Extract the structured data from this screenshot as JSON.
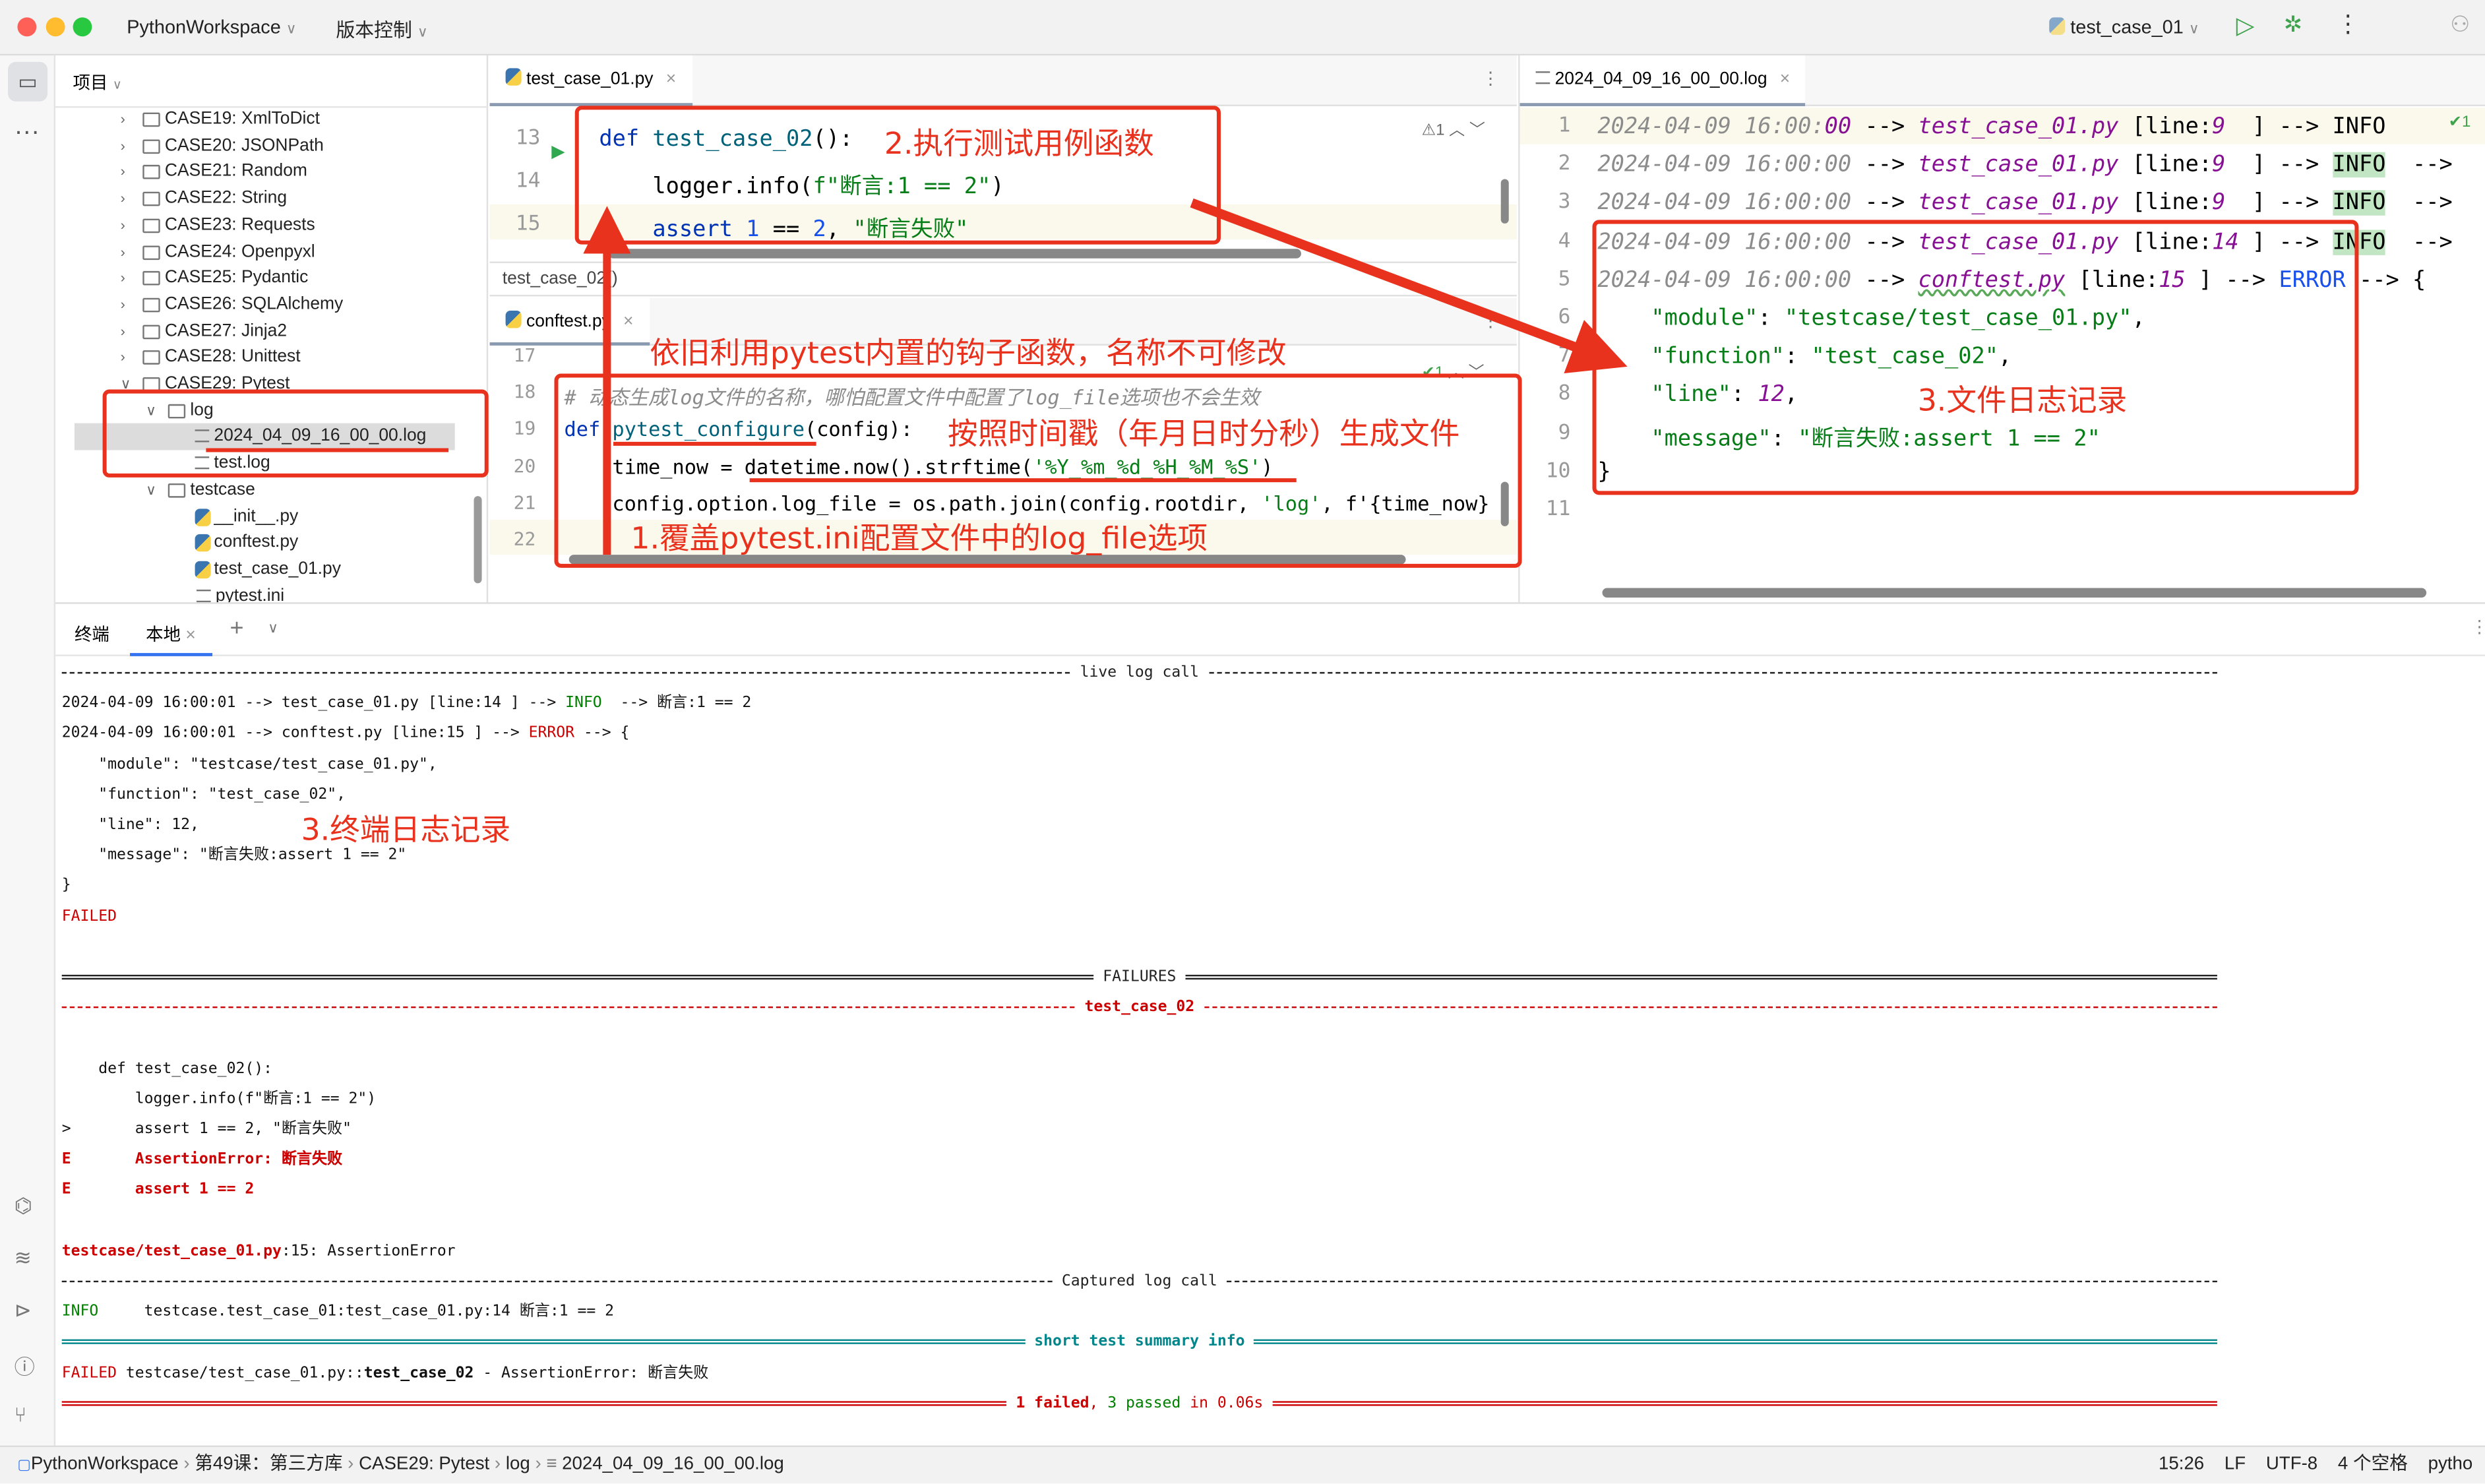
{
  "titlebar": {
    "project": "PythonWorkspace",
    "vcs": "版本控制",
    "run_config": "test_case_01"
  },
  "project_panel": {
    "title": "项目",
    "items": [
      {
        "label": "CASE19: XmlToDict",
        "type": "folder",
        "level": 0,
        "expanded": false
      },
      {
        "label": "CASE20: JSONPath",
        "type": "folder",
        "level": 0,
        "expanded": false
      },
      {
        "label": "CASE21: Random",
        "type": "folder",
        "level": 0,
        "expanded": false
      },
      {
        "label": "CASE22: String",
        "type": "folder",
        "level": 0,
        "expanded": false
      },
      {
        "label": "CASE23: Requests",
        "type": "folder",
        "level": 0,
        "expanded": false
      },
      {
        "label": "CASE24: Openpyxl",
        "type": "folder",
        "level": 0,
        "expanded": false
      },
      {
        "label": "CASE25: Pydantic",
        "type": "folder",
        "level": 0,
        "expanded": false
      },
      {
        "label": "CASE26: SQLAlchemy",
        "type": "folder",
        "level": 0,
        "expanded": false
      },
      {
        "label": "CASE27: Jinja2",
        "type": "folder",
        "level": 0,
        "expanded": false
      },
      {
        "label": "CASE28: Unittest",
        "type": "folder",
        "level": 0,
        "expanded": false
      },
      {
        "label": "CASE29: Pytest",
        "type": "folder",
        "level": 0,
        "expanded": true
      },
      {
        "label": "log",
        "type": "folder",
        "level": 1,
        "expanded": true
      },
      {
        "label": "2024_04_09_16_00_00.log",
        "type": "text",
        "level": 2,
        "selected": true
      },
      {
        "label": "test.log",
        "type": "text",
        "level": 2
      },
      {
        "label": "testcase",
        "type": "folder",
        "level": 1,
        "expanded": true
      },
      {
        "label": "__init__.py",
        "type": "python",
        "level": 2
      },
      {
        "label": "conftest.py",
        "type": "python",
        "level": 2
      },
      {
        "label": "test_case_01.py",
        "type": "python",
        "level": 2
      },
      {
        "label": "pytest.ini",
        "type": "ini",
        "level": 1
      }
    ]
  },
  "editor_top": {
    "tab": "test_case_01.py",
    "breadcrumb": "test_case_02()",
    "inspection": "1",
    "lines": [
      {
        "n": "13",
        "tokens": [
          [
            "def ",
            "kw"
          ],
          [
            "test_case_02",
            "fn"
          ],
          [
            "():",
            ""
          ]
        ]
      },
      {
        "n": "14",
        "tokens": [
          [
            "    logger.info(",
            ""
          ],
          [
            "f\"断言:1 == 2\"",
            "str"
          ],
          [
            ")",
            ""
          ]
        ]
      },
      {
        "n": "15",
        "tokens": [
          [
            "    ",
            ""
          ],
          [
            "assert ",
            "kw"
          ],
          [
            "1",
            "num"
          ],
          [
            " == ",
            ""
          ],
          [
            "2",
            "num"
          ],
          [
            ", ",
            ""
          ],
          [
            "\"断言失败\"",
            "str"
          ]
        ]
      }
    ]
  },
  "editor_bottom": {
    "tab": "conftest.py",
    "inspection": "1",
    "lines": [
      {
        "n": "17",
        "tokens": []
      },
      {
        "n": "18",
        "tokens": [
          [
            "# 动态生成log文件的名称，哪怕配置文件中配置了log_file选项也不会生效",
            "cm"
          ]
        ]
      },
      {
        "n": "19",
        "tokens": [
          [
            "def ",
            "kw"
          ],
          [
            "pytest_configure",
            "fn"
          ],
          [
            "(config):",
            ""
          ]
        ]
      },
      {
        "n": "20",
        "tokens": [
          [
            "    time_now = datetime.now().strftime(",
            ""
          ],
          [
            "'%Y_%m_%d_%H_%M_%S'",
            "str"
          ],
          [
            ")",
            ""
          ]
        ]
      },
      {
        "n": "21",
        "tokens": [
          [
            "    config.option.log_file = os.path.join(config.rootdir, ",
            ""
          ],
          [
            "'log'",
            "str"
          ],
          [
            ", f'{time_now}",
            ""
          ]
        ]
      },
      {
        "n": "22",
        "tokens": []
      }
    ]
  },
  "editor_log": {
    "tab": "2024_04_09_16_00_00.log",
    "inspection": "1",
    "lines": [
      {
        "n": "1",
        "tokens": [
          [
            "2024-04-09 16:00:",
            "ts"
          ],
          [
            "00",
            "ts2"
          ],
          [
            " --> ",
            ""
          ],
          [
            "test_case_01.py",
            "pf"
          ],
          [
            " [line:",
            ""
          ],
          [
            "9",
            "pn"
          ],
          [
            "  ] --> ",
            ""
          ],
          [
            "INFO",
            ""
          ]
        ]
      },
      {
        "n": "2",
        "tokens": [
          [
            "2024-04-09 16:00:00",
            "ts"
          ],
          [
            " --> ",
            ""
          ],
          [
            "test_case_01.py",
            "pf"
          ],
          [
            " [line:",
            ""
          ],
          [
            "9",
            "pn"
          ],
          [
            "  ] --> ",
            ""
          ],
          [
            "INFO",
            "info-bg"
          ],
          [
            "  -->",
            ""
          ]
        ]
      },
      {
        "n": "3",
        "tokens": [
          [
            "2024-04-09 16:00:00",
            "ts"
          ],
          [
            " --> ",
            ""
          ],
          [
            "test_case_01.py",
            "pf"
          ],
          [
            " [line:",
            ""
          ],
          [
            "9",
            "pn"
          ],
          [
            "  ] --> ",
            ""
          ],
          [
            "INFO",
            "info-bg"
          ],
          [
            "  -->",
            ""
          ]
        ]
      },
      {
        "n": "4",
        "tokens": [
          [
            "2024-04-09 16:00:00",
            "ts"
          ],
          [
            " --> ",
            ""
          ],
          [
            "test_case_01.py",
            "pf"
          ],
          [
            " [line:",
            ""
          ],
          [
            "14",
            "pn"
          ],
          [
            " ] --> ",
            ""
          ],
          [
            "INFO",
            "info-bg"
          ],
          [
            "  -->",
            ""
          ]
        ]
      },
      {
        "n": "5",
        "tokens": [
          [
            "2024-04-09 16:00:00",
            "ts"
          ],
          [
            " --> ",
            ""
          ],
          [
            "conftest.py",
            "pf wavy"
          ],
          [
            " [line:",
            ""
          ],
          [
            "15",
            "pn"
          ],
          [
            " ] --> ",
            ""
          ],
          [
            "ERROR",
            "err"
          ],
          [
            " --> {",
            ""
          ]
        ]
      },
      {
        "n": "6",
        "tokens": [
          [
            "    ",
            ""
          ],
          [
            "\"module\"",
            "str"
          ],
          [
            ": ",
            ""
          ],
          [
            "\"testcase/test_case_01.py\"",
            "str"
          ],
          [
            ",",
            ""
          ]
        ]
      },
      {
        "n": "7",
        "tokens": [
          [
            "    ",
            ""
          ],
          [
            "\"function\"",
            "str"
          ],
          [
            ": ",
            ""
          ],
          [
            "\"test_case_02\"",
            "str"
          ],
          [
            ",",
            ""
          ]
        ]
      },
      {
        "n": "8",
        "tokens": [
          [
            "    ",
            ""
          ],
          [
            "\"line\"",
            "str"
          ],
          [
            ": ",
            ""
          ],
          [
            "12",
            "pn"
          ],
          [
            ",",
            ""
          ]
        ]
      },
      {
        "n": "9",
        "tokens": [
          [
            "    ",
            ""
          ],
          [
            "\"message\"",
            "str"
          ],
          [
            ": ",
            ""
          ],
          [
            "\"断言失败:assert 1 == 2\"",
            "str"
          ]
        ]
      },
      {
        "n": "10",
        "tokens": [
          [
            "}",
            ""
          ]
        ]
      },
      {
        "n": "11",
        "tokens": []
      }
    ]
  },
  "terminal": {
    "title": "终端",
    "tab": "本地",
    "rows": [
      {
        "sep": "live log call",
        "style": "dash",
        "color": "#222"
      },
      {
        "tokens": [
          [
            "2024-04-09 16:00:01 --> test_case_01.py [line:14 ] --> ",
            ""
          ],
          [
            "INFO",
            "t-green"
          ],
          [
            "  --> 断言:1 == 2",
            ""
          ]
        ]
      },
      {
        "tokens": [
          [
            "2024-04-09 16:00:01 --> conftest.py [line:15 ] --> ",
            ""
          ],
          [
            "ERROR",
            "t-red"
          ],
          [
            " --> {",
            ""
          ]
        ]
      },
      {
        "tokens": [
          [
            "    \"module\": \"testcase/test_case_01.py\",",
            ""
          ]
        ]
      },
      {
        "tokens": [
          [
            "    \"function\": \"test_case_02\",",
            ""
          ]
        ]
      },
      {
        "tokens": [
          [
            "    \"line\": 12,",
            ""
          ]
        ]
      },
      {
        "tokens": [
          [
            "    \"message\": \"断言失败:assert 1 == 2\"",
            ""
          ]
        ]
      },
      {
        "tokens": [
          [
            "}",
            ""
          ]
        ]
      },
      {
        "tokens": [
          [
            "FAILED",
            "t-red"
          ]
        ]
      },
      {
        "tokens": []
      },
      {
        "sep": "FAILURES",
        "style": "double",
        "color": "#222"
      },
      {
        "sep": "test_case_02",
        "style": "dash",
        "color": "#cc0000",
        "bold": true
      },
      {
        "tokens": []
      },
      {
        "tokens": [
          [
            "    def test_case_02():",
            ""
          ]
        ]
      },
      {
        "tokens": [
          [
            "        logger.info(f\"断言:1 == 2\")",
            ""
          ]
        ]
      },
      {
        "tokens": [
          [
            ">       assert 1 == 2, \"断言失败\"",
            ""
          ]
        ]
      },
      {
        "tokens": [
          [
            "E       AssertionError: 断言失败",
            "t-red t-bold"
          ]
        ]
      },
      {
        "tokens": [
          [
            "E       assert 1 == 2",
            "t-red t-bold"
          ]
        ]
      },
      {
        "tokens": []
      },
      {
        "tokens": [
          [
            "testcase/test_case_01.py",
            "t-red t-bold"
          ],
          [
            ":15: AssertionError",
            ""
          ]
        ]
      },
      {
        "sep": "Captured log call",
        "style": "dash",
        "color": "#222"
      },
      {
        "tokens": [
          [
            "INFO",
            "t-green"
          ],
          [
            "     testcase.test_case_01:test_case_01.py:14 断言:1 == 2",
            ""
          ]
        ]
      },
      {
        "sep": "short test summary info",
        "style": "double",
        "color": "#00868b",
        "bold": true
      },
      {
        "tokens": [
          [
            "FAILED",
            "t-red"
          ],
          [
            " testcase/test_case_01.py::",
            ""
          ],
          [
            "test_case_02",
            "t-bold"
          ],
          [
            " - AssertionError: 断言失败",
            ""
          ]
        ]
      },
      {
        "sepTokens": [
          [
            "1 failed",
            "t-red t-bold"
          ],
          [
            ", ",
            ""
          ],
          [
            "3 passed",
            "t-green"
          ],
          [
            " in 0.06s",
            "t-red"
          ]
        ],
        "style": "double",
        "color": "#cc0000"
      }
    ]
  },
  "annotations": {
    "run_test": "2.执行测试用例函数",
    "hook": "依旧利用pytest内置的钩子函数，名称不可修改",
    "timestamp": "按照时间戳（年月日时分秒）生成文件",
    "override": "1.覆盖pytest.ini配置文件中的log_file选项",
    "file_log": "3.文件日志记录",
    "terminal_log": "3.终端日志记录"
  },
  "statusbar": {
    "breadcrumb": [
      "PythonWorkspace",
      "第49课：第三方库",
      "CASE29: Pytest",
      "log",
      "2024_04_09_16_00_00.log"
    ],
    "position": "15:26",
    "line_sep": "LF",
    "encoding": "UTF-8",
    "indent": "4 个空格",
    "interpreter": "pytho"
  },
  "colors": {
    "annotation": "#e8321e",
    "keyword": "#0033b3",
    "string": "#067d17",
    "error": "#cc0000",
    "success": "#008000"
  }
}
